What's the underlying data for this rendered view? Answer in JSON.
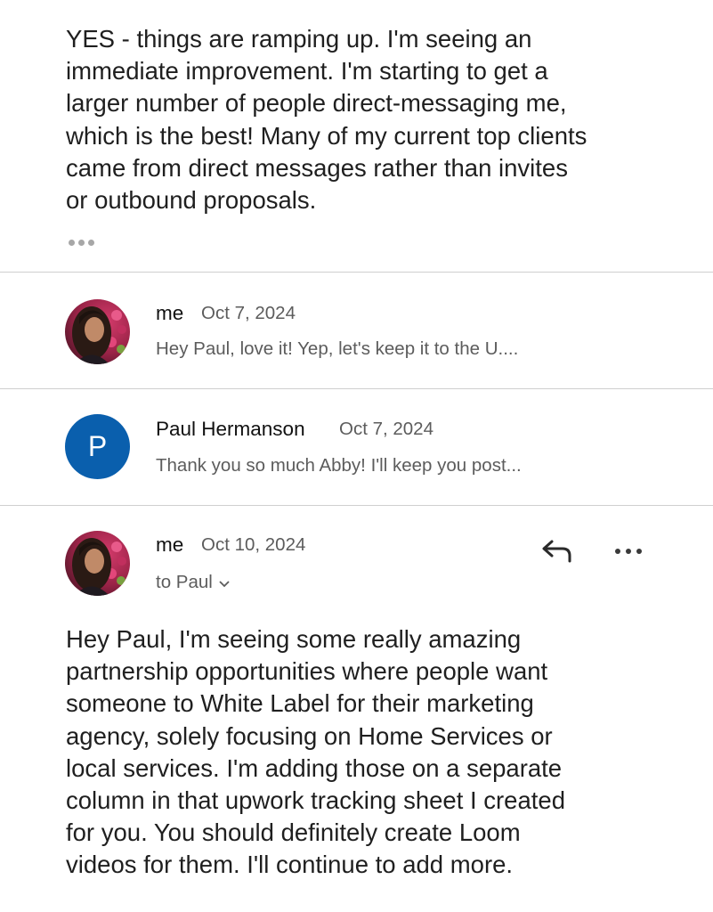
{
  "quoted_message": {
    "body": "YES - things are ramping up. I'm seeing an\nimmediate improvement. I'm starting to get a\nlarger number of people direct-messaging me,\nwhich is the best! Many of my current top clients\ncame from direct messages rather than invites\nor outbound proposals.",
    "more_icon": "ellipsis-icon"
  },
  "thread": [
    {
      "sender": "me",
      "date": "Oct 7, 2024",
      "snippet": "Hey Paul, love it! Yep, let's keep it to the U....",
      "avatar": "profile-photo"
    },
    {
      "sender": "Paul Hermanson",
      "date": "Oct 7, 2024",
      "snippet": "Thank you so much Abby! I'll keep you post...",
      "avatar_letter": "P",
      "avatar_color": "#0a5fad"
    }
  ],
  "open_message": {
    "sender": "me",
    "date": "Oct 10, 2024",
    "recipient_label": "to Paul",
    "reply_icon": "reply-icon",
    "more_icon": "more-options-icon",
    "body": "Hey Paul, I'm seeing some really amazing\npartnership opportunities where people want\nsomeone to White Label for their marketing\nagency, solely focusing on Home Services or\nlocal services. I'm adding those on a separate\ncolumn in that upwork tracking sheet I created\nfor you. You should definitely create Loom\nvideos for them. I'll continue to add more."
  },
  "colors": {
    "divider": "#cfcfcf",
    "secondary_text": "#5c5c5c",
    "avatar_blue": "#0a5fad"
  }
}
